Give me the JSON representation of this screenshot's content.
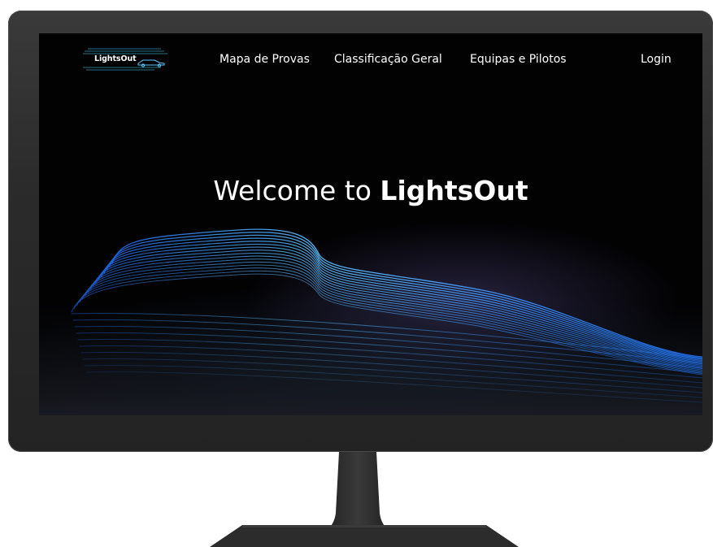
{
  "site": {
    "logo_text": "LightsOut",
    "logo_icon": "race-car-icon"
  },
  "nav": {
    "items": [
      {
        "label": "Mapa de Provas"
      },
      {
        "label": "Classificação Geral"
      },
      {
        "label": "Equipas e Pilotos"
      }
    ],
    "login_label": "Login"
  },
  "hero": {
    "title_prefix": "Welcome to ",
    "title_brand": "LightsOut",
    "image": "light-trail-car"
  },
  "colors": {
    "screen_bg": "#020203",
    "accent_blue": "#3aa0ff",
    "text": "#ffffff",
    "bezel": "#2b2b2b"
  }
}
